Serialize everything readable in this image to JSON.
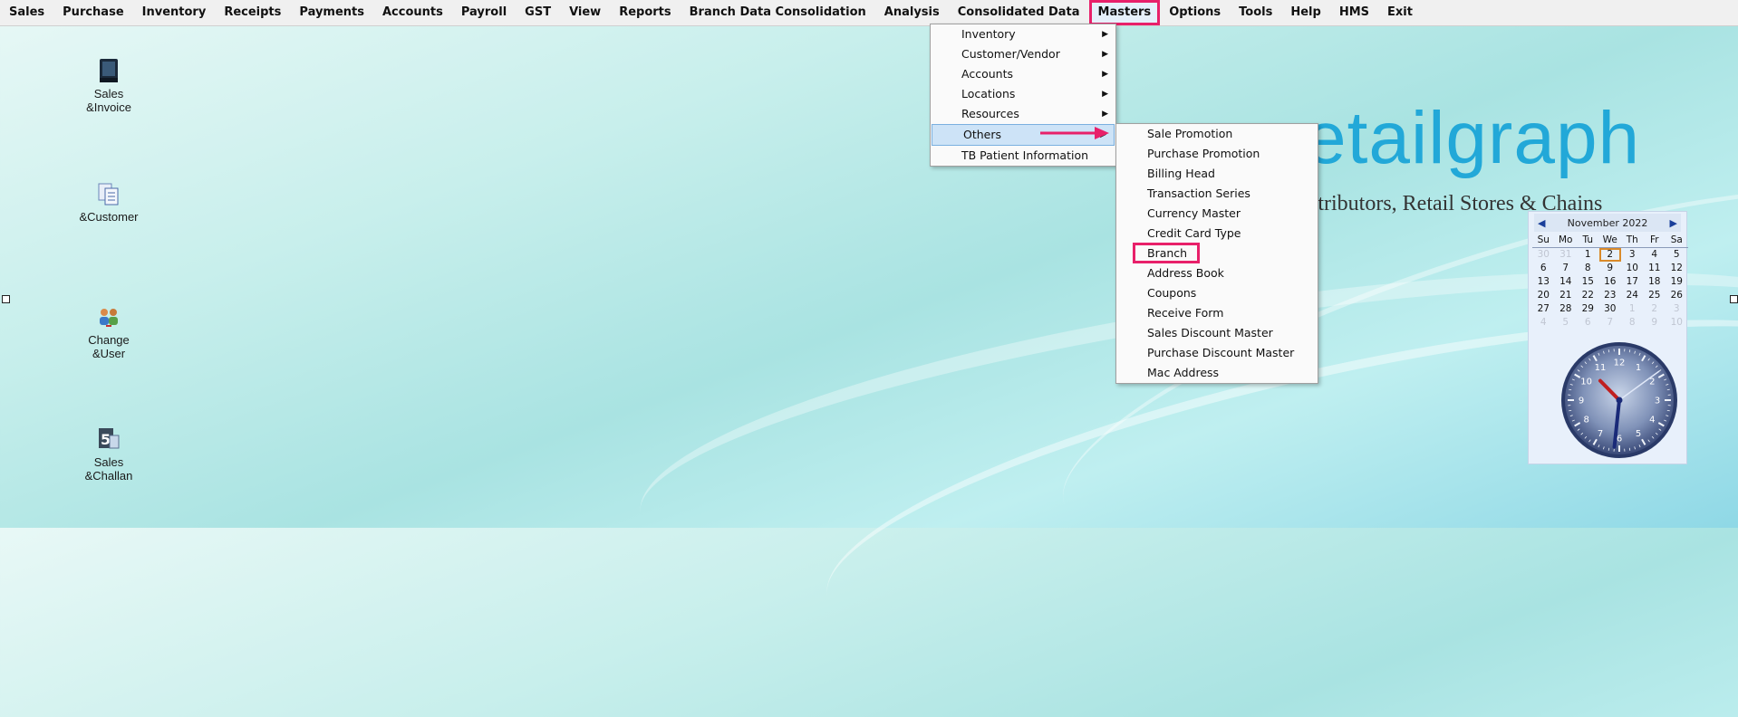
{
  "menubar": {
    "items": [
      {
        "label": "Sales"
      },
      {
        "label": "Purchase"
      },
      {
        "label": "Inventory"
      },
      {
        "label": "Receipts"
      },
      {
        "label": "Payments"
      },
      {
        "label": "Accounts"
      },
      {
        "label": "Payroll"
      },
      {
        "label": "GST"
      },
      {
        "label": "View"
      },
      {
        "label": "Reports"
      },
      {
        "label": "Branch Data Consolidation"
      },
      {
        "label": "Analysis"
      },
      {
        "label": "Consolidated Data"
      },
      {
        "label": "Masters"
      },
      {
        "label": "Options"
      },
      {
        "label": "Tools"
      },
      {
        "label": "Help"
      },
      {
        "label": "HMS"
      },
      {
        "label": "Exit"
      }
    ],
    "active": "Masters"
  },
  "desktop_icons": [
    {
      "label": "Sales\n&Invoice",
      "icon": "book-icon"
    },
    {
      "label": "&Customer",
      "icon": "documents-icon"
    },
    {
      "label": "Change\n&User",
      "icon": "users-icon"
    },
    {
      "label": "Sales\n&Challan",
      "icon": "challan-icon"
    }
  ],
  "masters_menu": {
    "items": [
      {
        "label": "Inventory",
        "submenu": true
      },
      {
        "label": "Customer/Vendor",
        "submenu": true
      },
      {
        "label": "Accounts",
        "submenu": true
      },
      {
        "label": "Locations",
        "submenu": true
      },
      {
        "label": "Resources",
        "submenu": true
      },
      {
        "label": "Others",
        "submenu": true,
        "selected": true
      },
      {
        "label": "TB Patient Information",
        "submenu": false
      }
    ]
  },
  "others_menu": {
    "items": [
      {
        "label": "Sale Promotion"
      },
      {
        "label": "Purchase Promotion"
      },
      {
        "label": "Billing Head"
      },
      {
        "label": "Transaction Series"
      },
      {
        "label": "Currency Master"
      },
      {
        "label": "Credit Card Type"
      },
      {
        "label": "Branch",
        "highlighted": true
      },
      {
        "label": "Address Book"
      },
      {
        "label": "Coupons"
      },
      {
        "label": "Receive Form"
      },
      {
        "label": "Sales Discount Master"
      },
      {
        "label": "Purchase Discount Master"
      },
      {
        "label": "Mac Address"
      }
    ]
  },
  "logo": {
    "text": "etailgraph",
    "tagline": "stributors, Retail Stores & Chains"
  },
  "calendar": {
    "month_label": "November 2022",
    "weekdays": [
      "Su",
      "Mo",
      "Tu",
      "We",
      "Th",
      "Fr",
      "Sa"
    ],
    "days": [
      {
        "n": "30",
        "other": true
      },
      {
        "n": "31",
        "other": true
      },
      {
        "n": "1"
      },
      {
        "n": "2",
        "today": true
      },
      {
        "n": "3"
      },
      {
        "n": "4"
      },
      {
        "n": "5"
      },
      {
        "n": "6"
      },
      {
        "n": "7"
      },
      {
        "n": "8"
      },
      {
        "n": "9"
      },
      {
        "n": "10"
      },
      {
        "n": "11"
      },
      {
        "n": "12"
      },
      {
        "n": "13"
      },
      {
        "n": "14"
      },
      {
        "n": "15"
      },
      {
        "n": "16"
      },
      {
        "n": "17"
      },
      {
        "n": "18"
      },
      {
        "n": "19"
      },
      {
        "n": "20"
      },
      {
        "n": "21"
      },
      {
        "n": "22"
      },
      {
        "n": "23"
      },
      {
        "n": "24"
      },
      {
        "n": "25"
      },
      {
        "n": "26"
      },
      {
        "n": "27"
      },
      {
        "n": "28"
      },
      {
        "n": "29"
      },
      {
        "n": "30"
      },
      {
        "n": "1",
        "other": true
      },
      {
        "n": "2",
        "other": true
      },
      {
        "n": "3",
        "other": true
      },
      {
        "n": "4",
        "other": true
      },
      {
        "n": "5",
        "other": true
      },
      {
        "n": "6",
        "other": true
      },
      {
        "n": "7",
        "other": true
      },
      {
        "n": "8",
        "other": true
      },
      {
        "n": "9",
        "other": true
      },
      {
        "n": "10",
        "other": true
      }
    ]
  },
  "clock": {
    "numbers": [
      "12",
      "1",
      "2",
      "3",
      "4",
      "5",
      "6",
      "7",
      "8",
      "9",
      "10",
      "11"
    ],
    "hour": 10,
    "minute": 31,
    "second": 9
  },
  "colors": {
    "accent": "#e8206a",
    "logo": "#22a8d8",
    "selection": "#cde3f7"
  }
}
